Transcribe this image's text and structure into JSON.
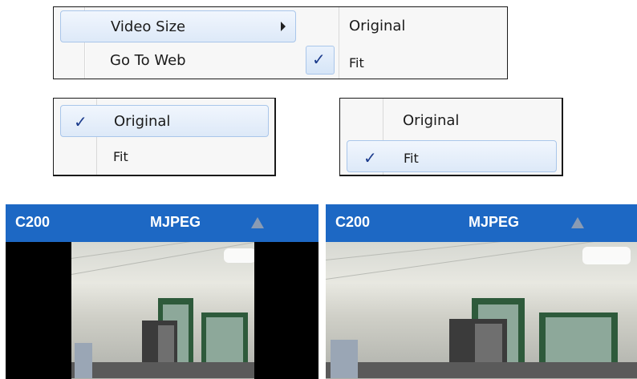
{
  "menu_top": {
    "items": [
      {
        "label": "Video Size",
        "has_submenu": true
      },
      {
        "label": "Go To Web"
      }
    ],
    "submenu": [
      {
        "label": "Original",
        "checked": false
      },
      {
        "label": "Fit",
        "checked": true
      }
    ]
  },
  "menu_original": {
    "items": [
      {
        "label": "Original",
        "checked": true
      },
      {
        "label": "Fit",
        "checked": false
      }
    ]
  },
  "menu_fit": {
    "items": [
      {
        "label": "Original",
        "checked": false
      },
      {
        "label": "Fit",
        "checked": true
      }
    ]
  },
  "check_glyph": "✓",
  "panels": [
    {
      "camera": "C200",
      "codec": "MJPEG",
      "mode": "Original"
    },
    {
      "camera": "C200",
      "codec": "MJPEG",
      "mode": "Fit"
    }
  ],
  "colors": {
    "title_bar": "#1d68c4",
    "highlight_border": "#a9c6ea",
    "check": "#1b3b8c"
  }
}
